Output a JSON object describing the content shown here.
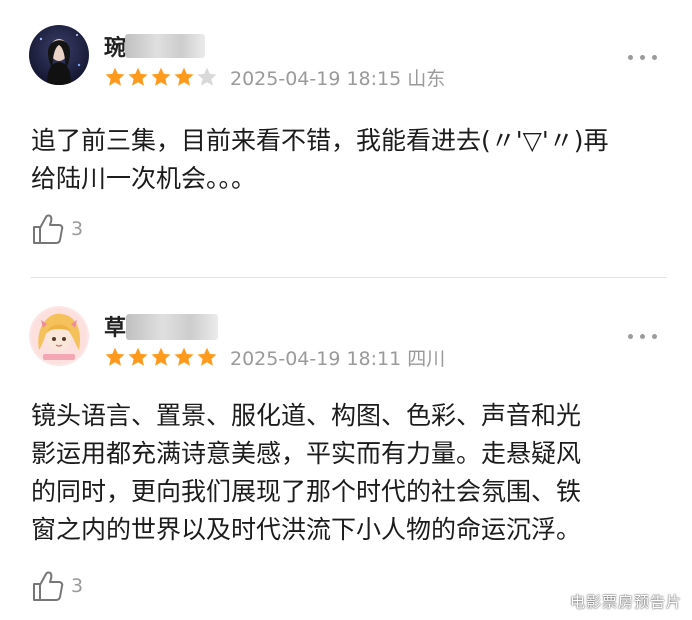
{
  "reviews": [
    {
      "username_visible": "琬",
      "rating": 4,
      "rating_max": 5,
      "date": "2025-04-19 18:15",
      "location": "山东",
      "content_line1": "追了前三集，目前来看不错，我能看进去(〃'▽'〃)再",
      "content_line2": "给陆川一次机会。。。",
      "likes": "3",
      "avatar_icon": "dark-portrait-avatar-icon"
    },
    {
      "username_visible": "草",
      "rating": 5,
      "rating_max": 5,
      "date": "2025-04-19 18:11",
      "location": "四川",
      "content_line1": "镜头语言、置景、服化道、构图、色彩、声音和光",
      "content_line2": "影运用都充满诗意美感，平实而有力量。走悬疑风",
      "content_line3": "的同时，更向我们展现了那个时代的社会氛围、铁",
      "content_line4": "窗之内的世界以及时代洪流下小人物的命运沉浮。",
      "likes": "3",
      "avatar_icon": "anime-girl-avatar-icon"
    }
  ],
  "colors": {
    "star_filled": "#ff9a1f",
    "star_empty": "#d9d9d9",
    "meta_text": "#9a9a9a"
  },
  "watermark": "电影票房预告片"
}
